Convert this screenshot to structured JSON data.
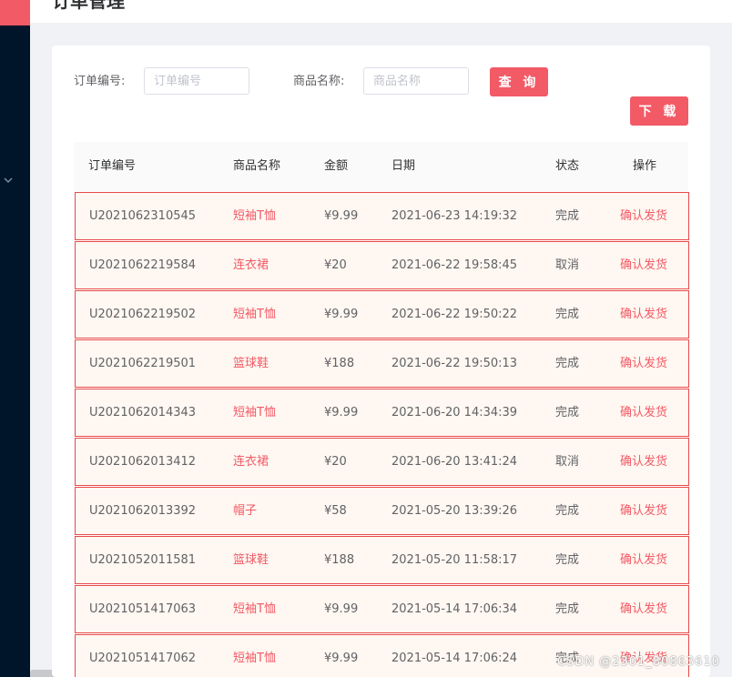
{
  "header": {
    "title": "订单管理"
  },
  "search": {
    "order_label": "订单编号:",
    "order_placeholder": "订单编号",
    "product_label": "商品名称:",
    "product_placeholder": "商品名称",
    "query_button": "查 询",
    "download_button": "下 载"
  },
  "table": {
    "columns": [
      "订单编号",
      "商品名称",
      "金额",
      "日期",
      "状态",
      "操作"
    ],
    "rows": [
      {
        "order_id": "U2021062310545",
        "product": "短袖T恤",
        "amount": "¥9.99",
        "date": "2021-06-23 14:19:32",
        "status": "完成",
        "action": "确认发货"
      },
      {
        "order_id": "U2021062219584",
        "product": "连衣裙",
        "amount": "¥20",
        "date": "2021-06-22 19:58:45",
        "status": "取消",
        "action": "确认发货"
      },
      {
        "order_id": "U2021062219502",
        "product": "短袖T恤",
        "amount": "¥9.99",
        "date": "2021-06-22 19:50:22",
        "status": "完成",
        "action": "确认发货"
      },
      {
        "order_id": "U2021062219501",
        "product": "篮球鞋",
        "amount": "¥188",
        "date": "2021-06-22 19:50:13",
        "status": "完成",
        "action": "确认发货"
      },
      {
        "order_id": "U2021062014343",
        "product": "短袖T恤",
        "amount": "¥9.99",
        "date": "2021-06-20 14:34:39",
        "status": "完成",
        "action": "确认发货"
      },
      {
        "order_id": "U2021062013412",
        "product": "连衣裙",
        "amount": "¥20",
        "date": "2021-06-20 13:41:24",
        "status": "取消",
        "action": "确认发货"
      },
      {
        "order_id": "U2021062013392",
        "product": "帽子",
        "amount": "¥58",
        "date": "2021-05-20 13:39:26",
        "status": "完成",
        "action": "确认发货"
      },
      {
        "order_id": "U2021052011581",
        "product": "篮球鞋",
        "amount": "¥188",
        "date": "2021-05-20 11:58:17",
        "status": "完成",
        "action": "确认发货"
      },
      {
        "order_id": "U2021051417063",
        "product": "短袖T恤",
        "amount": "¥9.99",
        "date": "2021-05-14 17:06:34",
        "status": "完成",
        "action": "确认发货"
      },
      {
        "order_id": "U2021051417062",
        "product": "短袖T恤",
        "amount": "¥9.99",
        "date": "2021-05-14 17:06:24",
        "status": "完成",
        "action": "确认发货"
      }
    ]
  },
  "watermark": "CSDN @2301_80863610",
  "colors": {
    "accent": "#f25a66",
    "sidebar": "#001529",
    "row_border": "#e84a4a",
    "row_bg": "#fff7f1"
  }
}
